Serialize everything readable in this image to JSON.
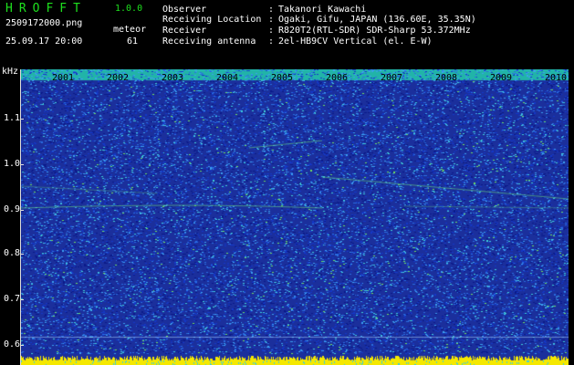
{
  "header": {
    "app_title": "HROFFT",
    "app_version": "1.0.0",
    "file_name": "2509172000.png",
    "mode": "meteor",
    "timestamp": "25.09.17 20:00",
    "count": "61"
  },
  "info": [
    {
      "key": "Observer",
      "value": "Takanori Kawachi"
    },
    {
      "key": "Receiving Location",
      "value": "Ogaki, Gifu, JAPAN (136.60E, 35.35N)"
    },
    {
      "key": "Receiver",
      "value": "R820T2(RTL-SDR) SDR-Sharp 53.372MHz"
    },
    {
      "key": "Receiving antenna",
      "value": "2el-HB9CV Vertical (el. E-W)"
    }
  ],
  "separator": ":",
  "chart_data": {
    "type": "heatmap",
    "ylabel": "kHz",
    "y_ticks": [
      "1.1",
      "1.0",
      "0.9",
      "0.8",
      "0.7",
      "0.6"
    ],
    "x_ticks": [
      "2001",
      "2002",
      "2003",
      "2004",
      "2005",
      "2006",
      "2007",
      "2008",
      "2009",
      "2010"
    ],
    "colors": {
      "background": "#1b2f9c",
      "noise": [
        "#0a1a8a",
        "#1438c8",
        "#2a6de0",
        "#3ca0f0",
        "#40d0d8",
        "#6fe060"
      ],
      "header_band": "#21b4a8",
      "bottom_band": "#f5e800"
    }
  }
}
